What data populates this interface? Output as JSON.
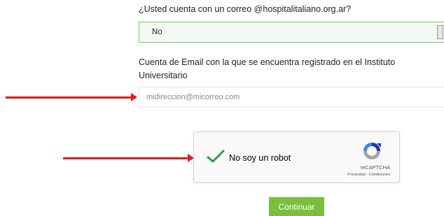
{
  "form": {
    "hospital_email_question": "¿Usted cuenta con un correo @hospitalitaliano.org.ar?",
    "hospital_email_select": {
      "selected": "No"
    },
    "registered_email_label": "Cuenta de Email con la que se encuentra registrado en el Instituto Universitario",
    "registered_email_input": {
      "value": "",
      "placeholder": "midireccion@micorreo.com"
    },
    "submit_label": "Continuar"
  },
  "captcha": {
    "checkbox_label": "No soy un robot",
    "checked": true,
    "brand": "reCAPTCHA",
    "links": "Privacidad - Condiciones"
  },
  "annotations": {
    "arrow_color": "#e31b1b"
  },
  "colors": {
    "submit_button": "#79bf3b",
    "select_border": "#7dc26b",
    "check_mark": "#2e9e3e"
  },
  "icons": [
    "dropdown-arrow-icon",
    "checkmark-icon",
    "recaptcha-logo-icon",
    "red-arrow-icon"
  ]
}
